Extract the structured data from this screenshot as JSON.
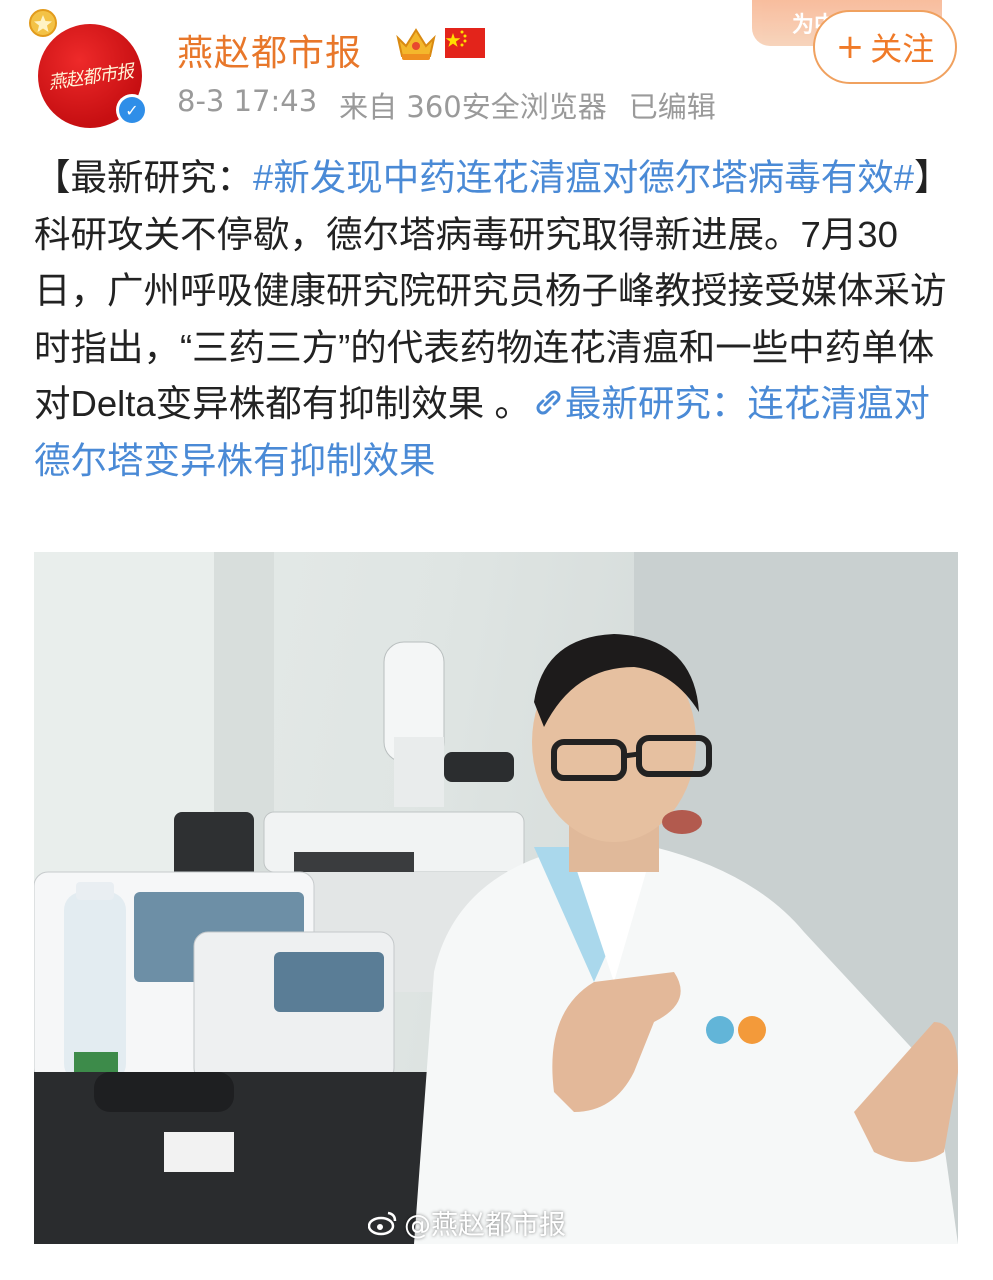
{
  "user": {
    "name": "燕赵都市报",
    "avatar_text": "燕赵都市报",
    "vip_badge": "crown-vip-icon",
    "flag": "china-flag-icon",
    "verified_icon": "verified-check-icon"
  },
  "meta": {
    "time": "8-3 17:43",
    "source": "来自 360安全浏览器",
    "edited": "已编辑"
  },
  "promo_badge": "为中国加油",
  "follow_button": {
    "plus": "+",
    "label": "关注"
  },
  "post": {
    "prefix": "【最新研究：",
    "hashtag": "#新发现中药连花清瘟对德尔塔病毒有效#",
    "body": "】科研攻关不停歇，德尔塔病毒研究取得新进展。7月30日，广州呼吸健康研究院研究员杨子峰教授接受媒体采访时指出，“三药三方”的代表药物连花清瘟和一些中药单体对Delta变异株都有抑制效果 。",
    "link_text": "最新研究：连花清瘟对德尔塔变异株有抑制效果"
  },
  "image": {
    "watermark": "@燕赵都市报"
  },
  "colors": {
    "username": "#e8772a",
    "link": "#4a8ad6",
    "meta": "#9a9a9a",
    "follow": "#f07a28"
  }
}
